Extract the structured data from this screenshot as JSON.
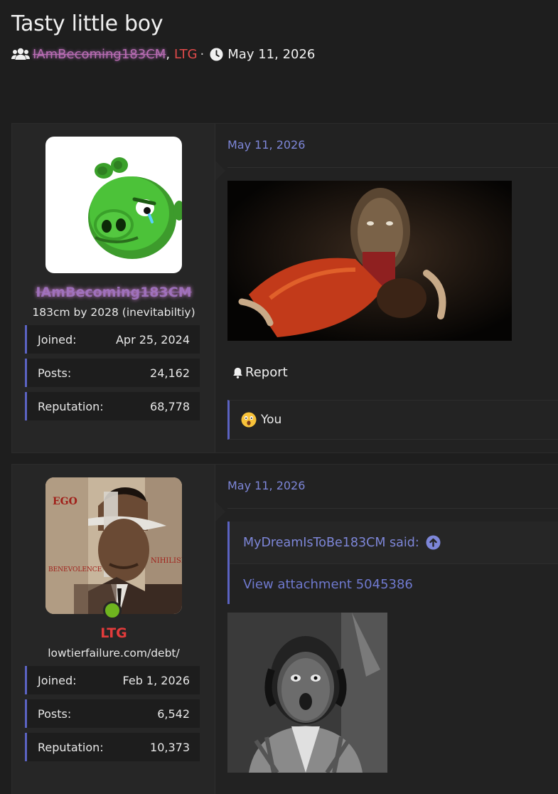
{
  "thread": {
    "title": "Tasty little boy",
    "author_1": "IAmBecoming183CM",
    "author_2": "LTG",
    "separator": "·",
    "date": "May 11, 2026"
  },
  "posts": [
    {
      "username": "IAmBecoming183CM",
      "user_title": "183cm by 2028 (inevitabiltiy)",
      "stats": [
        {
          "label": "Joined:",
          "value": "Apr 25, 2024"
        },
        {
          "label": "Posts:",
          "value": "24,162"
        },
        {
          "label": "Reputation:",
          "value": "68,778"
        }
      ],
      "date": "May 11, 2026",
      "report_label": "Report",
      "reaction_text": "You",
      "avatar_icon": "green-pig-avatar",
      "media_icon": "horror-scene-image"
    },
    {
      "username": "LTG",
      "user_title": "lowtierfailure.com/debt/",
      "stats": [
        {
          "label": "Joined:",
          "value": "Feb 1, 2026"
        },
        {
          "label": "Posts:",
          "value": "6,542"
        },
        {
          "label": "Reputation:",
          "value": "10,373"
        }
      ],
      "date": "May 11, 2026",
      "quote_author": "MyDreamIsToBe183CM said:",
      "quote_text": "View attachment 5045386",
      "avatar_icon": "collage-portrait-avatar",
      "media_icon": "shocked-man-image"
    }
  ],
  "colors": {
    "accent": "#5b63c2",
    "link": "#7d86d8",
    "red_name": "#e23b3b",
    "online": "#6fb51f",
    "background": "#1e1e1e"
  }
}
